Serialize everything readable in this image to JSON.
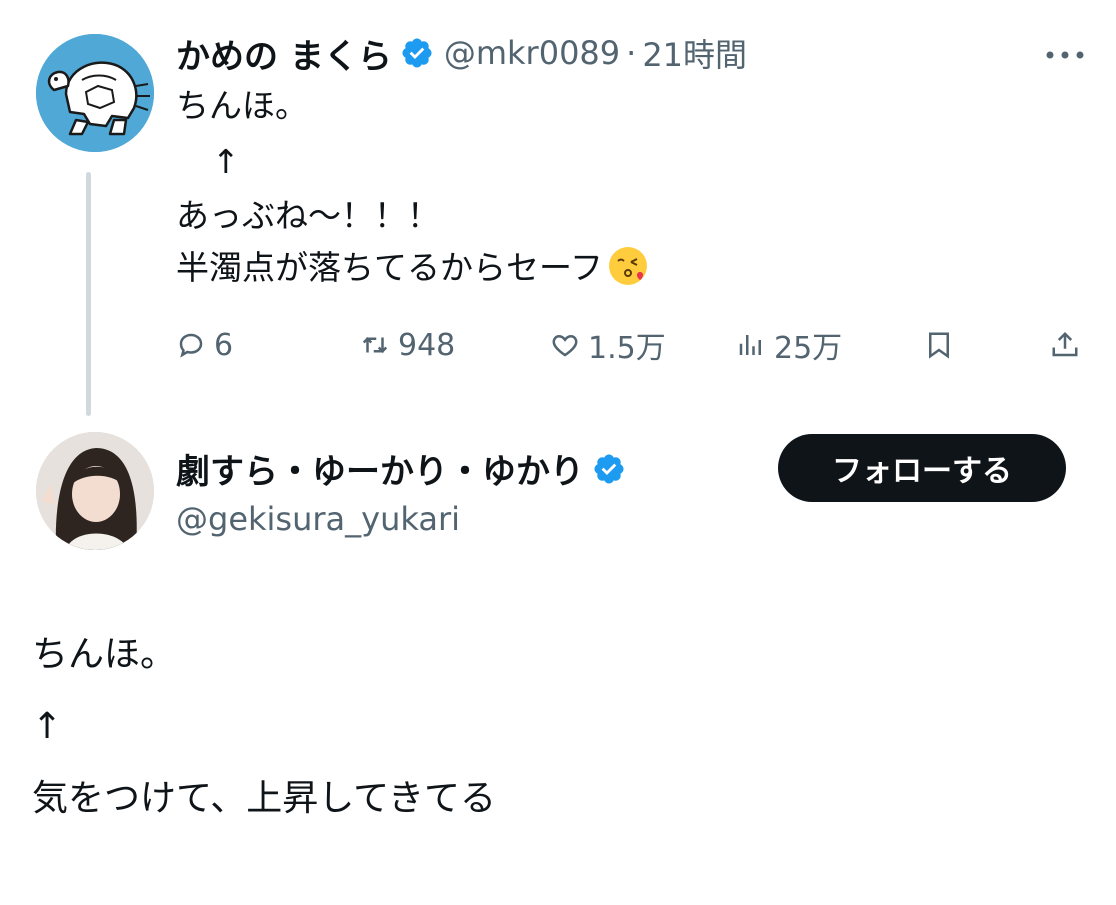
{
  "tweet1": {
    "display_name": "かめの まくら",
    "handle": "@mkr0089",
    "separator": "·",
    "time": "21時間",
    "lines": [
      "ちんほ。",
      "↑",
      "あっぶね〜！！！",
      "半濁点が落ちてるからセーフ"
    ],
    "emoji": "kissing-face-emoji",
    "actions": {
      "replies": "6",
      "reposts": "948",
      "likes": "1.5万",
      "views": "25万"
    }
  },
  "tweet2": {
    "display_name": "劇すら・ゆーかり・ゆかり",
    "handle": "@gekisura_yukari",
    "follow_label": "フォローする",
    "lines": [
      "ちんほ。",
      "↑",
      "気をつけて、上昇してきてる"
    ]
  },
  "colors": {
    "text": "#0f1419",
    "secondary": "#536471",
    "verified": "#1d9bf0",
    "avatar1_bg": "#4fa8d6",
    "thread_line": "#cfd9de"
  }
}
